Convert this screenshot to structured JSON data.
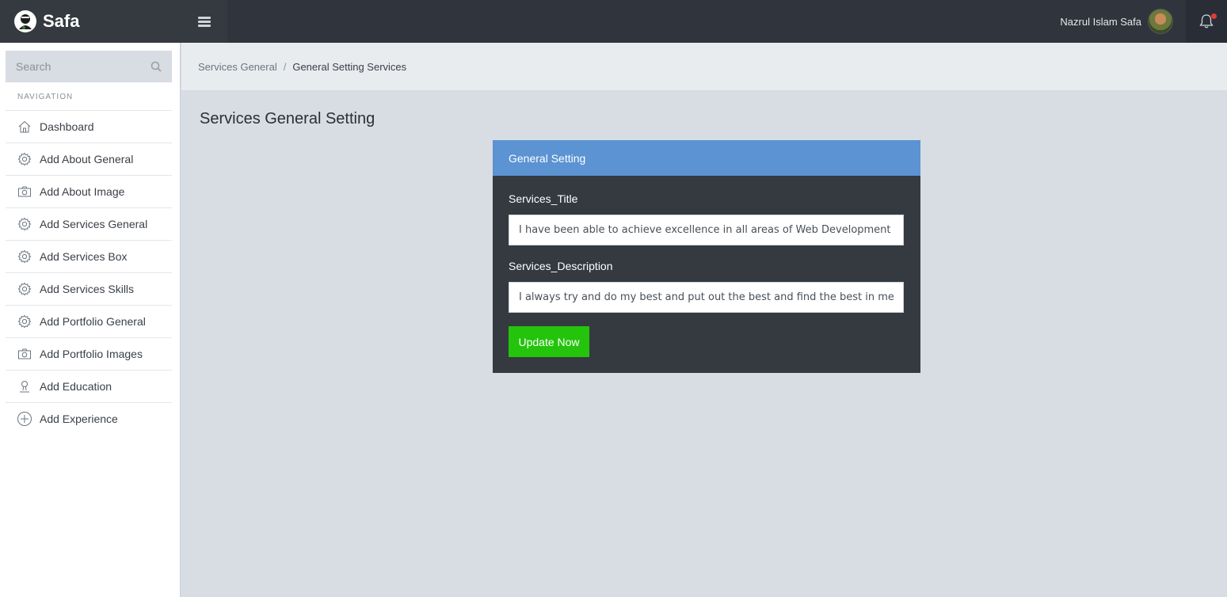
{
  "brand": {
    "name": "Safa"
  },
  "user": {
    "name": "Nazrul Islam Safa"
  },
  "sidebar": {
    "search_placeholder": "Search",
    "nav_title": "NAVIGATION",
    "items": [
      {
        "label": "Dashboard",
        "icon": "home-icon"
      },
      {
        "label": "Add About General",
        "icon": "gear-icon"
      },
      {
        "label": "Add About Image",
        "icon": "camera-icon"
      },
      {
        "label": "Add Services General",
        "icon": "gear-icon"
      },
      {
        "label": "Add Services Box",
        "icon": "gear-icon"
      },
      {
        "label": "Add Services Skills",
        "icon": "gear-icon"
      },
      {
        "label": "Add Portfolio General",
        "icon": "gear-icon"
      },
      {
        "label": "Add Portfolio Images",
        "icon": "camera-icon"
      },
      {
        "label": "Add Education",
        "icon": "user-icon"
      },
      {
        "label": "Add Experience",
        "icon": "plus-circle-icon"
      }
    ]
  },
  "breadcrumb": {
    "parent": "Services General",
    "separator": "/",
    "current": "General Setting Services"
  },
  "page": {
    "title": "Services General Setting"
  },
  "card": {
    "header": "General Setting",
    "title_label": "Services_Title",
    "title_value": "I have been able to achieve excellence in all areas of Web Development and W",
    "description_label": "Services_Description",
    "description_value": "I always try and do my best and put out the best and find the best in me. As a",
    "submit_label": "Update Now"
  },
  "colors": {
    "topbar": "#2f343d",
    "card_header": "#5b93d3",
    "card_body": "#343a40",
    "update_button": "#24c40c",
    "content_bg": "#d8dce3"
  }
}
